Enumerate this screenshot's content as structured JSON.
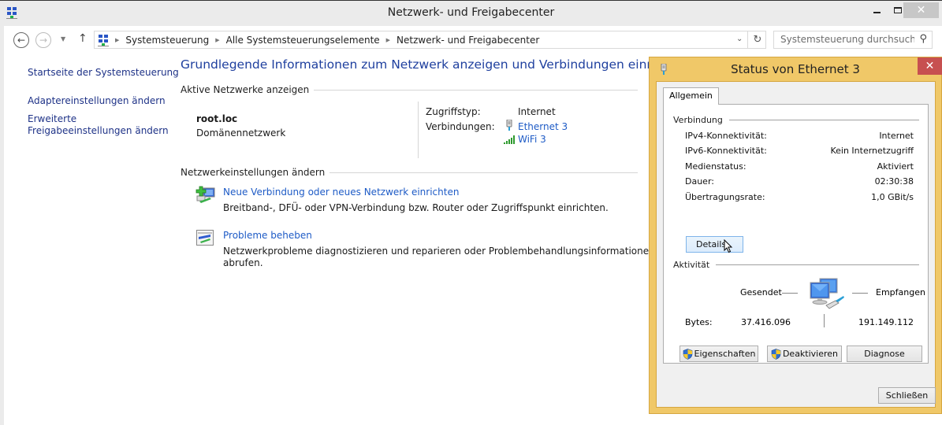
{
  "window": {
    "title": "Netzwerk- und Freigabecenter",
    "icon": "network-sharing-icon"
  },
  "navigation": {
    "back_icon": "back-arrow-icon",
    "forward_icon": "forward-arrow-icon",
    "recent_icon": "chevron-down-icon",
    "up_icon": "up-arrow-icon",
    "breadcrumbs": [
      "Systemsteuerung",
      "Alle Systemsteuerungselemente",
      "Netzwerk- und Freigabecenter"
    ],
    "search_placeholder": "Systemsteuerung durchsuchen"
  },
  "sidebar": {
    "items": [
      {
        "label": "Startseite der Systemsteuerung"
      },
      {
        "label": "Adaptereinstellungen ändern"
      },
      {
        "label": "Erweiterte\nFreigabeeinstellungen ändern",
        "line1": "Erweiterte",
        "line2": "Freigabeeinstellungen ändern"
      }
    ]
  },
  "main": {
    "title": "Grundlegende Informationen zum Netzwerk anzeigen und Verbindungen einrichten",
    "active_networks_heading": "Aktive Netzwerke anzeigen",
    "network": {
      "name": "root.loc",
      "type": "Domänennetzwerk",
      "access_type_label": "Zugriffstyp:",
      "access_type_value": "Internet",
      "connections_label": "Verbindungen:",
      "connections": [
        {
          "name": "Ethernet 3",
          "icon": "ethernet-icon"
        },
        {
          "name": "WiFi 3",
          "icon": "wifi-signal-icon"
        }
      ]
    },
    "settings_heading": "Netzwerkeinstellungen ändern",
    "tasks": [
      {
        "title": "Neue Verbindung oder neues Netzwerk einrichten",
        "description": "Breitband-, DFÜ- oder VPN-Verbindung bzw. Router oder Zugriffspunkt einrichten.",
        "icon": "new-connection-icon"
      },
      {
        "title": "Probleme beheben",
        "description_line1": "Netzwerkprobleme diagnostizieren und reparieren oder Problembehandlungsinformationen",
        "description_line2": "abrufen.",
        "icon": "troubleshoot-icon"
      }
    ]
  },
  "dialog": {
    "title": "Status von Ethernet 3",
    "tab": "Allgemein",
    "connection_heading": "Verbindung",
    "rows": [
      {
        "label": "IPv4-Konnektivität:",
        "value": "Internet"
      },
      {
        "label": "IPv6-Konnektivität:",
        "value": "Kein Internetzugriff"
      },
      {
        "label": "Medienstatus:",
        "value": "Aktiviert"
      },
      {
        "label": "Dauer:",
        "value": "02:30:38"
      },
      {
        "label": "Übertragungsrate:",
        "value": "1,0 GBit/s"
      }
    ],
    "details_button": "Details...",
    "details_button_display": "Details.",
    "activity_heading": "Aktivität",
    "sent_label": "Gesendet",
    "received_label": "Empfangen",
    "bytes_label": "Bytes:",
    "bytes_sent": "37.416.096",
    "bytes_received": "191.149.112",
    "buttons": {
      "properties": "Eigenschaften",
      "disable": "Deaktivieren",
      "diagnose": "Diagnose",
      "close": "Schließen"
    }
  },
  "colors": {
    "link": "#1e5bc6",
    "title_blue": "#1e3f9e",
    "dialog_frame": "#f0c868",
    "dialog_close": "#c75050"
  }
}
